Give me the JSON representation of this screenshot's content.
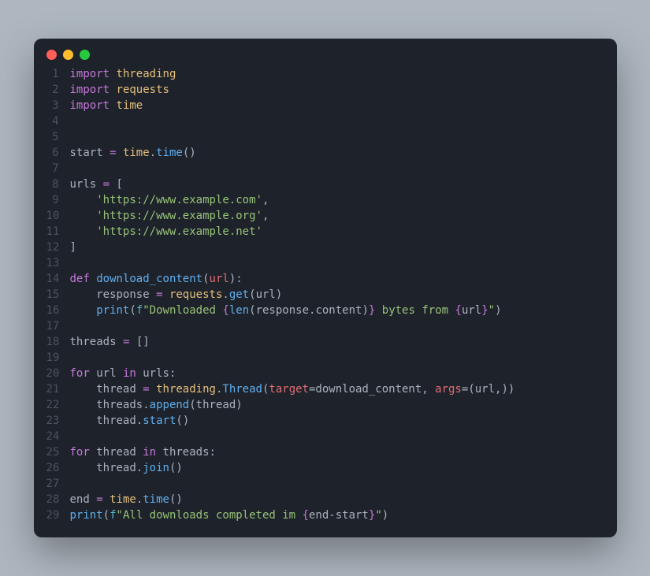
{
  "window": {
    "traffic_lights": [
      "close",
      "minimize",
      "zoom"
    ]
  },
  "code": {
    "lines": [
      [
        {
          "c": "kw",
          "t": "import"
        },
        {
          "c": "op",
          "t": " "
        },
        {
          "c": "var",
          "t": "threading"
        }
      ],
      [
        {
          "c": "kw",
          "t": "import"
        },
        {
          "c": "op",
          "t": " "
        },
        {
          "c": "var",
          "t": "requests"
        }
      ],
      [
        {
          "c": "kw",
          "t": "import"
        },
        {
          "c": "op",
          "t": " "
        },
        {
          "c": "var",
          "t": "time"
        }
      ],
      [],
      [],
      [
        {
          "c": "id",
          "t": "start "
        },
        {
          "c": "eq",
          "t": "="
        },
        {
          "c": "id",
          "t": " "
        },
        {
          "c": "var",
          "t": "time"
        },
        {
          "c": "op",
          "t": "."
        },
        {
          "c": "func",
          "t": "time"
        },
        {
          "c": "paren",
          "t": "()"
        }
      ],
      [],
      [
        {
          "c": "id",
          "t": "urls "
        },
        {
          "c": "eq",
          "t": "="
        },
        {
          "c": "id",
          "t": " "
        },
        {
          "c": "paren",
          "t": "["
        }
      ],
      [
        {
          "c": "id",
          "t": "    "
        },
        {
          "c": "str",
          "t": "'https://www.example.com'"
        },
        {
          "c": "punct",
          "t": ","
        }
      ],
      [
        {
          "c": "id",
          "t": "    "
        },
        {
          "c": "str",
          "t": "'https://www.example.org'"
        },
        {
          "c": "punct",
          "t": ","
        }
      ],
      [
        {
          "c": "id",
          "t": "    "
        },
        {
          "c": "str",
          "t": "'https://www.example.net'"
        }
      ],
      [
        {
          "c": "paren",
          "t": "]"
        }
      ],
      [],
      [
        {
          "c": "kw",
          "t": "def"
        },
        {
          "c": "id",
          "t": " "
        },
        {
          "c": "func",
          "t": "download_content"
        },
        {
          "c": "paren",
          "t": "("
        },
        {
          "c": "param",
          "t": "url"
        },
        {
          "c": "paren",
          "t": ")"
        },
        {
          "c": "op",
          "t": ":"
        }
      ],
      [
        {
          "c": "id",
          "t": "    response "
        },
        {
          "c": "eq",
          "t": "="
        },
        {
          "c": "id",
          "t": " "
        },
        {
          "c": "var",
          "t": "requests"
        },
        {
          "c": "op",
          "t": "."
        },
        {
          "c": "func",
          "t": "get"
        },
        {
          "c": "paren",
          "t": "("
        },
        {
          "c": "id",
          "t": "url"
        },
        {
          "c": "paren",
          "t": ")"
        }
      ],
      [
        {
          "c": "id",
          "t": "    "
        },
        {
          "c": "func",
          "t": "print"
        },
        {
          "c": "paren",
          "t": "("
        },
        {
          "c": "attr",
          "t": "f"
        },
        {
          "c": "str",
          "t": "\"Downloaded "
        },
        {
          "c": "brace",
          "t": "{"
        },
        {
          "c": "func",
          "t": "len"
        },
        {
          "c": "paren",
          "t": "("
        },
        {
          "c": "id",
          "t": "response"
        },
        {
          "c": "op",
          "t": "."
        },
        {
          "c": "id",
          "t": "content"
        },
        {
          "c": "paren",
          "t": ")"
        },
        {
          "c": "brace",
          "t": "}"
        },
        {
          "c": "str",
          "t": " bytes from "
        },
        {
          "c": "brace",
          "t": "{"
        },
        {
          "c": "id",
          "t": "url"
        },
        {
          "c": "brace",
          "t": "}"
        },
        {
          "c": "str",
          "t": "\""
        },
        {
          "c": "paren",
          "t": ")"
        }
      ],
      [],
      [
        {
          "c": "id",
          "t": "threads "
        },
        {
          "c": "eq",
          "t": "="
        },
        {
          "c": "id",
          "t": " "
        },
        {
          "c": "paren",
          "t": "[]"
        }
      ],
      [],
      [
        {
          "c": "kw",
          "t": "for"
        },
        {
          "c": "id",
          "t": " url "
        },
        {
          "c": "kw",
          "t": "in"
        },
        {
          "c": "id",
          "t": " urls"
        },
        {
          "c": "op",
          "t": ":"
        }
      ],
      [
        {
          "c": "id",
          "t": "    thread "
        },
        {
          "c": "eq",
          "t": "="
        },
        {
          "c": "id",
          "t": " "
        },
        {
          "c": "var",
          "t": "threading"
        },
        {
          "c": "op",
          "t": "."
        },
        {
          "c": "func",
          "t": "Thread"
        },
        {
          "c": "paren",
          "t": "("
        },
        {
          "c": "param",
          "t": "target"
        },
        {
          "c": "op",
          "t": "="
        },
        {
          "c": "id",
          "t": "download_content"
        },
        {
          "c": "punct",
          "t": ", "
        },
        {
          "c": "param",
          "t": "args"
        },
        {
          "c": "op",
          "t": "="
        },
        {
          "c": "paren",
          "t": "("
        },
        {
          "c": "id",
          "t": "url"
        },
        {
          "c": "punct",
          "t": ","
        },
        {
          "c": "paren",
          "t": ")"
        },
        {
          "c": "paren",
          "t": ")"
        }
      ],
      [
        {
          "c": "id",
          "t": "    threads"
        },
        {
          "c": "op",
          "t": "."
        },
        {
          "c": "func",
          "t": "append"
        },
        {
          "c": "paren",
          "t": "("
        },
        {
          "c": "id",
          "t": "thread"
        },
        {
          "c": "paren",
          "t": ")"
        }
      ],
      [
        {
          "c": "id",
          "t": "    thread"
        },
        {
          "c": "op",
          "t": "."
        },
        {
          "c": "func",
          "t": "start"
        },
        {
          "c": "paren",
          "t": "()"
        }
      ],
      [],
      [
        {
          "c": "kw",
          "t": "for"
        },
        {
          "c": "id",
          "t": " thread "
        },
        {
          "c": "kw",
          "t": "in"
        },
        {
          "c": "id",
          "t": " threads"
        },
        {
          "c": "op",
          "t": ":"
        }
      ],
      [
        {
          "c": "id",
          "t": "    thread"
        },
        {
          "c": "op",
          "t": "."
        },
        {
          "c": "func",
          "t": "join"
        },
        {
          "c": "paren",
          "t": "()"
        }
      ],
      [],
      [
        {
          "c": "id",
          "t": "end "
        },
        {
          "c": "eq",
          "t": "="
        },
        {
          "c": "id",
          "t": " "
        },
        {
          "c": "var",
          "t": "time"
        },
        {
          "c": "op",
          "t": "."
        },
        {
          "c": "func",
          "t": "time"
        },
        {
          "c": "paren",
          "t": "()"
        }
      ],
      [
        {
          "c": "func",
          "t": "print"
        },
        {
          "c": "paren",
          "t": "("
        },
        {
          "c": "attr",
          "t": "f"
        },
        {
          "c": "str",
          "t": "\"All downloads completed im "
        },
        {
          "c": "brace",
          "t": "{"
        },
        {
          "c": "id",
          "t": "end"
        },
        {
          "c": "op",
          "t": "-"
        },
        {
          "c": "id",
          "t": "start"
        },
        {
          "c": "brace",
          "t": "}"
        },
        {
          "c": "str",
          "t": "\""
        },
        {
          "c": "paren",
          "t": ")"
        }
      ]
    ]
  }
}
